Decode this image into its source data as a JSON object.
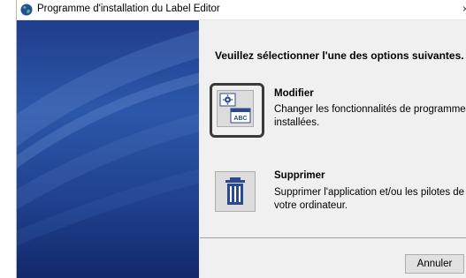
{
  "window": {
    "title": "Programme d'installation du Label Editor",
    "close_glyph": "×"
  },
  "main": {
    "heading": "Veuillez sélectionner l'une des options suivantes.",
    "options": [
      {
        "title": "Modifier",
        "description": "Changer les fonctionnalités de programme installées.",
        "icon": "modify-gear-abc-icon",
        "icon_text": "ABC",
        "selected": true
      },
      {
        "title": "Supprimer",
        "description": "Supprimer l'application et/ou les pilotes de votre ordinateur.",
        "icon": "trash-icon",
        "selected": false
      }
    ],
    "cancel_label": "Annuler"
  },
  "colors": {
    "side_panel": "#2d57aa",
    "selection_frame": "#3a3a3a",
    "icon_blue": "#2a4a8f"
  }
}
